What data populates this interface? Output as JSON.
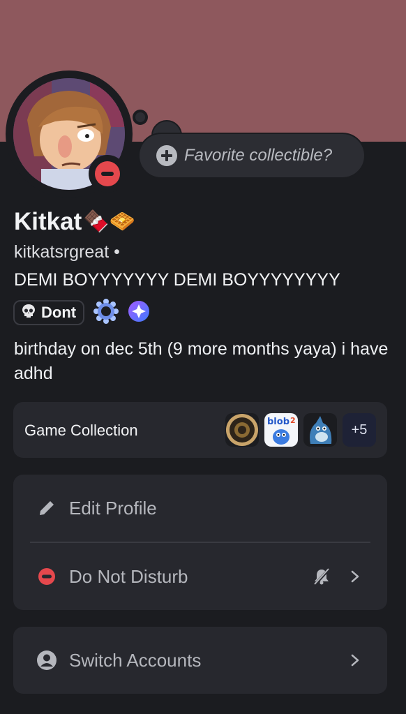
{
  "profile": {
    "display_name": "Kitkat",
    "display_name_emoji": "🍫🧇",
    "username": "kitkatsrgreat",
    "username_separator": "•",
    "pronouns": "DEMI BOYYYYYYY DEMI BOYYYYYYYY",
    "tag": {
      "icon": "skull-icon",
      "label": "Dont"
    },
    "badges": [
      "nitro-badge-icon",
      "boost-badge-icon"
    ],
    "bio": "birthday on dec 5th (9 more months yaya) i have adhd",
    "status": "do-not-disturb"
  },
  "collectible": {
    "placeholder": "Favorite collectible?"
  },
  "game_collection": {
    "label": "Game Collection",
    "games": [
      "coin-game-icon",
      "de-blob-2-icon",
      "blue-creature-game-icon"
    ],
    "more_label": "+5"
  },
  "menu": {
    "edit_profile": "Edit Profile",
    "do_not_disturb": "Do Not Disturb",
    "switch_accounts": "Switch Accounts"
  },
  "colors": {
    "banner": "#8e585d",
    "background": "#1b1c20",
    "card": "#27282e",
    "dnd_red": "#e5484d"
  }
}
